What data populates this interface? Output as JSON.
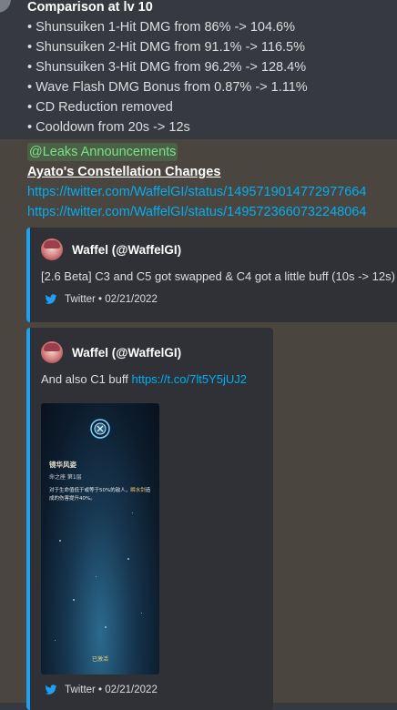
{
  "message_top": {
    "lines": [
      "Comparison at lv 10",
      "• Shunsuiken 1-Hit DMG from 86% -> 104.6%",
      "• Shunsuiken 2-Hit DMG from 91.1% -> 116.5%",
      "• Shunsuiken 3-Hit DMG from 96.2% -> 128.4%",
      "• Wave Flash DMG Bonus from 0.87% -> 1.11%",
      "• CD Reduction removed",
      "• Cooldown from 20s -> 12s"
    ]
  },
  "message_bottom": {
    "mention": "@Leaks Announcements",
    "heading": "Ayato's Constellation Changes",
    "links": [
      "https://twitter.com/WaffelGI/status/1495719014772977664",
      "https://twitter.com/WaffelGI/status/1495723660732248064"
    ]
  },
  "embeds": [
    {
      "author": "Waffel (@WaffelGI)",
      "text": "[2.6 Beta] C3 and C5 got swapped & C4 got a little buff (10s -> 12s)",
      "footer": "Twitter • 02/21/2022"
    },
    {
      "author": "Waffel (@WaffelGI)",
      "text": "And also C1 buff ",
      "link": "https://t.co/7lt5Y5jUJ2",
      "footer": "Twitter • 02/21/2022",
      "image": {
        "title": "镜华风姿",
        "subtitle": "命之座 第1层",
        "desc_pre": "对于生命值低于或等于50%的敌人，",
        "desc_hl": "瞬水剑",
        "desc_post": "造成的伤害提升40%。",
        "badge": "已激活"
      }
    }
  ],
  "colors": {
    "background_top": "#36393f",
    "background_bottom": "#4a453f",
    "embed": "#2f3136",
    "twitter": "#1da1f2",
    "link": "#00aff4",
    "mention": "#7de08a"
  }
}
